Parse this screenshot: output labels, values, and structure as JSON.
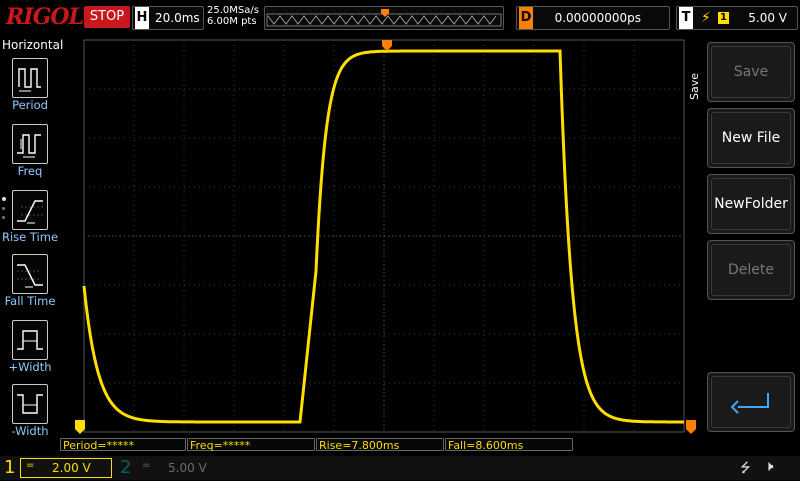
{
  "header": {
    "brand": "RIGOL",
    "run_state": "STOP",
    "horizontal_key": "H",
    "timebase": "20.0ms",
    "sample_rate": "25.0MSa/s",
    "memory_depth": "6.00M pts",
    "delay_key": "D",
    "delay_value": "0.00000000ps",
    "trigger_key": "T",
    "trigger_source": "1",
    "trigger_level": "5.00 V"
  },
  "left_menu": {
    "title": "Horizontal",
    "items": [
      {
        "label": "Period",
        "icon": "period-icon"
      },
      {
        "label": "Freq",
        "icon": "freq-icon"
      },
      {
        "label": "Rise Time",
        "icon": "rise-time-icon"
      },
      {
        "label": "Fall Time",
        "icon": "fall-time-icon"
      },
      {
        "label": "+Width",
        "icon": "positive-width-icon"
      },
      {
        "label": "-Width",
        "icon": "negative-width-icon"
      }
    ]
  },
  "right_menu": {
    "tab_label": "Save",
    "buttons": [
      {
        "label": "Save",
        "enabled": false
      },
      {
        "label": "New File",
        "enabled": true
      },
      {
        "label": "NewFolder",
        "enabled": true
      },
      {
        "label": "Delete",
        "enabled": false
      }
    ],
    "return_icon": "return-arrow-icon"
  },
  "measurements": [
    {
      "text": "Period=*****"
    },
    {
      "text": "Freq=*****"
    },
    {
      "text": "Rise=7.800ms"
    },
    {
      "text": "Fall=8.600ms"
    }
  ],
  "channels": [
    {
      "number": "1",
      "coupling": "=",
      "scale": "2.00 V",
      "color": "#ffde00",
      "active": true
    },
    {
      "number": "2",
      "coupling": "=",
      "scale": "5.00 V",
      "color": "#00a3a3",
      "active": false
    }
  ],
  "colors": {
    "trace": "#ffde00",
    "brand": "#c9171e",
    "stop": "#c9171e",
    "trigger_marker": "#ff7f00",
    "menu_label": "#8fc9ff"
  },
  "status_icons": [
    "usb-icon",
    "speaker-muted-icon"
  ]
}
